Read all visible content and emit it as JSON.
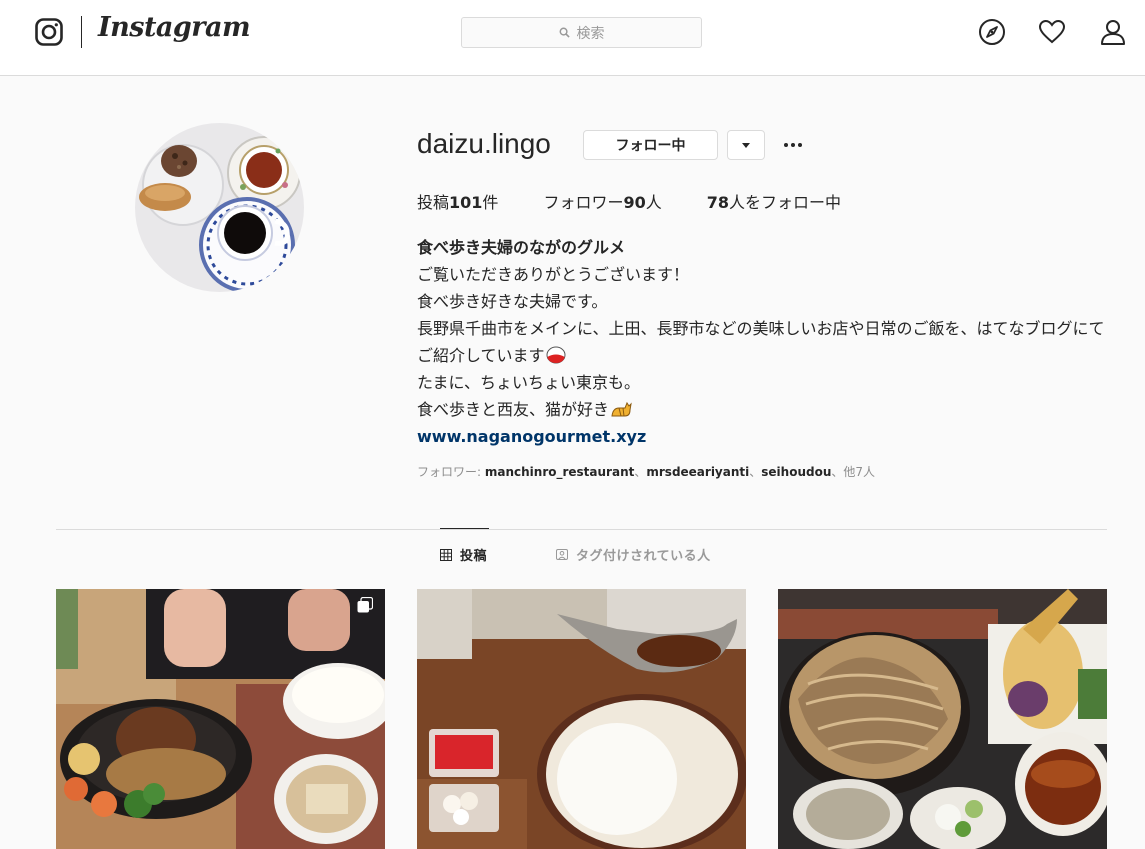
{
  "nav": {
    "wordmark": "Instagram",
    "search_placeholder": "検索",
    "icons": [
      "instagram-logo-icon",
      "search-icon",
      "explore-compass-icon",
      "heart-icon",
      "profile-icon"
    ]
  },
  "profile": {
    "username": "daizu.lingo",
    "follow_label": "フォロー中",
    "dropdown_icon": "caret-down-icon",
    "more_icon": "more-dots-icon",
    "stats": {
      "posts_label": "投稿",
      "posts_count": "101",
      "posts_unit": "件",
      "followers_label": "フォロワー",
      "followers_count": "90",
      "followers_unit": "人",
      "following_count": "78",
      "following_label": "人をフォロー中"
    },
    "bio": {
      "title": "食べ歩き夫婦のながのグルメ",
      "lines": [
        "ご覧いただきありがとうございます！",
        "食べ歩き好きな夫婦です。",
        "長野県千曲市をメインに、上田、長野市などの美味しいお店や日常のご飯を、はてなブログにてご紹介しています",
        "たまに、ちょいちょい東京も。",
        "食べ歩きと西友、猫が好き"
      ],
      "emoji_1": "rice-ball-icon",
      "emoji_2": "cat-icon",
      "link": "www.naganogourmet.xyz"
    },
    "followed_by": {
      "prefix": "フォロワー: ",
      "names": [
        "manchinro_restaurant",
        "mrsdeeariyanti",
        "seihoudou"
      ],
      "separator": "、",
      "suffix": "他7人"
    }
  },
  "tabs": [
    {
      "label": "投稿",
      "icon": "grid-icon",
      "active": true
    },
    {
      "label": "タグ付けされている人",
      "icon": "tagged-person-icon",
      "active": false
    }
  ],
  "posts": [
    {
      "subject": "hamburg steak on iron skillet with rice and soup",
      "icon": "multi-photo-icon"
    },
    {
      "subject": "curry roux in gravy boat with rice and pickles"
    },
    {
      "subject": "soba noodles with tempura and dipping sauce"
    }
  ],
  "colors": {
    "link": "#003569",
    "border": "#dbdbdb",
    "muted": "#8e8e8e",
    "bg": "#fafafa"
  }
}
